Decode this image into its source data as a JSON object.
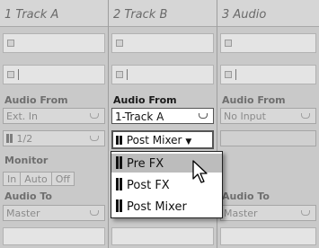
{
  "tracks": [
    {
      "name": "1 Track A",
      "audio_from_label": "Audio From",
      "audio_from_value": "Ext. In",
      "channel_value": "1/2",
      "monitor_label": "Monitor",
      "monitor_in": "In",
      "monitor_auto": "Auto",
      "monitor_off": "Off",
      "audio_to_label": "Audio To",
      "audio_to_value": "Master"
    },
    {
      "name": "2 Track B",
      "audio_from_label": "Audio From",
      "audio_from_value": "1-Track A",
      "tap_value": "Post Mixer"
    },
    {
      "name": "3 Audio",
      "audio_from_label": "Audio From",
      "audio_from_value": "No Input",
      "audio_to_label": "Audio To",
      "audio_to_value": "Master"
    }
  ],
  "menu": {
    "items": [
      {
        "label": "Pre FX",
        "selected": true
      },
      {
        "label": "Post FX",
        "selected": false
      },
      {
        "label": "Post Mixer",
        "selected": false
      }
    ]
  },
  "colors": {
    "selection": "#bcbcbc",
    "background": "#c9c9c9"
  }
}
